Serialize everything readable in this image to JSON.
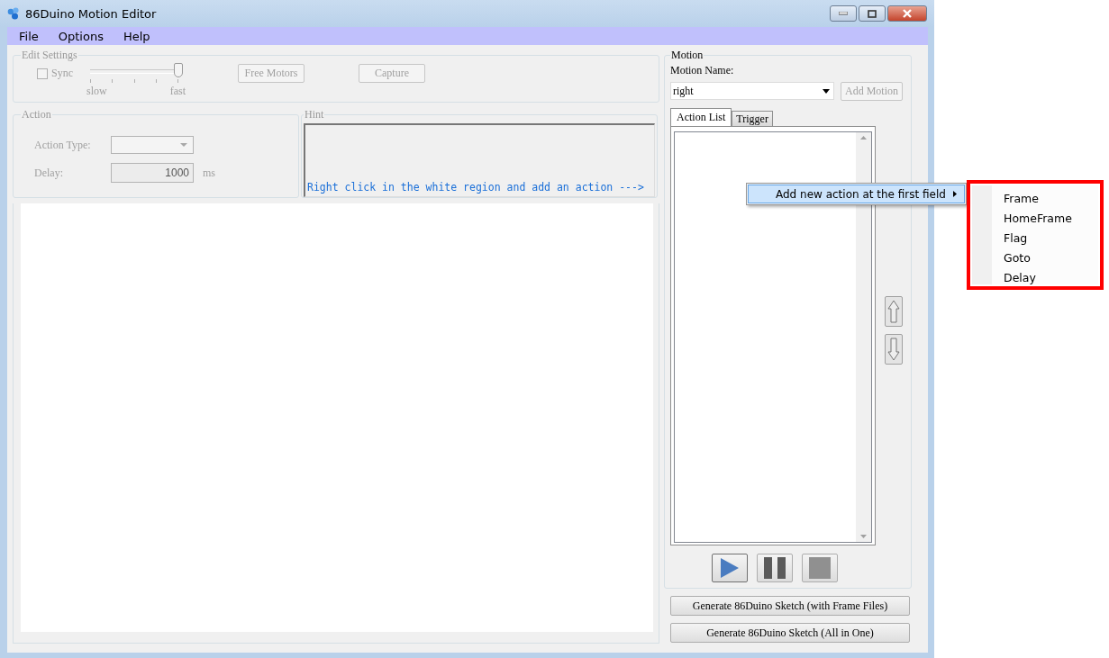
{
  "window": {
    "title": "86Duino Motion Editor"
  },
  "menu": [
    {
      "label": "File"
    },
    {
      "label": "Options"
    },
    {
      "label": "Help"
    }
  ],
  "edit_settings": {
    "title": "Edit Settings",
    "disabled": true,
    "sync": {
      "label": "Sync",
      "checked": false
    },
    "speed": {
      "min_label": "slow",
      "max_label": "fast",
      "level": 1
    },
    "buttons": [
      {
        "label": "Free Motors"
      },
      {
        "label": "Capture"
      }
    ]
  },
  "action": {
    "title": "Action",
    "disabled": true,
    "type_label": "Action Type:",
    "delay_label": "Delay:",
    "delay_value": "1000",
    "delay_unit": "ms"
  },
  "hint": {
    "title": "Hint",
    "text": "Right click in the white region and add an action --->"
  },
  "motion": {
    "title": "Motion",
    "name_label": "Motion Name:",
    "name_value": "right",
    "add_button": {
      "label": "Add Motion",
      "disabled": true
    },
    "tabs": [
      {
        "label": "Action List",
        "selected": true
      },
      {
        "label": "Trigger",
        "selected": false
      }
    ],
    "playback": [
      {
        "kind": "play"
      },
      {
        "kind": "pause"
      },
      {
        "kind": "stop"
      }
    ]
  },
  "generate_buttons": [
    {
      "label": "Generate 86Duino Sketch (with Frame Files)"
    },
    {
      "label": "Generate 86Duino Sketch (All in One)"
    }
  ],
  "context_menu": {
    "items": [
      {
        "label": "Add new action at the first field",
        "highlighted": true,
        "submenu": [
          {
            "label": "Frame"
          },
          {
            "label": "HomeFrame"
          },
          {
            "label": "Flag"
          },
          {
            "label": "Goto"
          },
          {
            "label": "Delay"
          }
        ]
      }
    ]
  }
}
